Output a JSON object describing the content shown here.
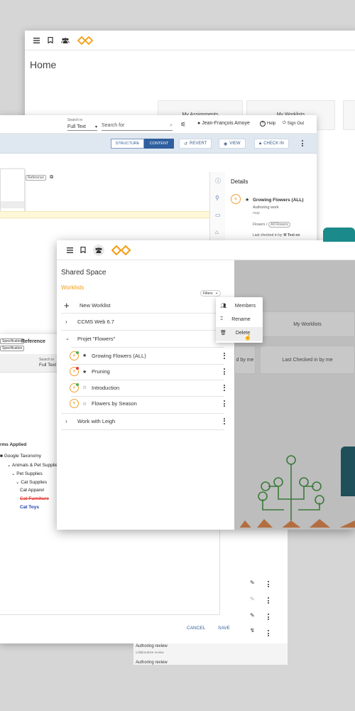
{
  "back_window": {
    "page_title": "Home",
    "tiles": [
      "My Assignments",
      "My Worklists"
    ]
  },
  "mid_window": {
    "search_in_label": "Search in",
    "search_in_value": "Full Text",
    "search_placeholder": "Search for",
    "user_name": "Jean-François Amoye",
    "help_label": "Help",
    "signout_label": "Sign Out",
    "structure_tab": "STRUCTURE",
    "content_tab": "CONTENT",
    "revert_label": "REVERT",
    "view_label": "VIEW",
    "checkin_label": "CHECK IN",
    "reference_chip": "Reference",
    "details": {
      "title": "Details",
      "item_title": "Growing Flowers (ALL)",
      "item_sub": "Authoring work",
      "item_type": "map",
      "path_prefix": "Flowers /",
      "path_chip": "All Flowers",
      "last_checked_prefix": "Last checked in by",
      "last_checked_user": "M Test on"
    }
  },
  "left_window": {
    "chips": [
      "Specification",
      "Specification"
    ],
    "reference_label": "Reference",
    "search_in_label": "Search in",
    "search_in_value": "Full Text",
    "terms_heading": "rms Applied",
    "tree": [
      {
        "label": "Google Taxonomy",
        "level": 0
      },
      {
        "label": "Animals & Pet Supplies",
        "level": 1
      },
      {
        "label": "Pet Supplies",
        "level": 2
      },
      {
        "label": "Cat Supplies",
        "level": 3
      },
      {
        "label": "Cat Apparel",
        "level": 4
      },
      {
        "label": "Cat Furniture",
        "level": 4
      },
      {
        "label": "Cat Toys",
        "level": 4
      }
    ],
    "cancel_label": "CANCEL",
    "save_label": "SAVE",
    "bottom_items": [
      "Authoring review",
      "collaborative review",
      "Authoring review"
    ]
  },
  "front_window": {
    "title": "Shared Space",
    "section": "Worklists",
    "filters_label": "Filters",
    "new_worklist": "New Worklist",
    "groups": [
      {
        "label": "CCMS Web 6.7"
      },
      {
        "label": "Projet \"Flowers\""
      }
    ],
    "items": [
      {
        "label": "Growing Flowers (ALL)",
        "star": "★",
        "dot": "#4caf50"
      },
      {
        "label": "Pruning",
        "star": "★",
        "dot": "#e53935"
      },
      {
        "label": "Introduction",
        "star": "☆",
        "dot": "#4caf50"
      },
      {
        "label": "Flowers by Season",
        "star": "☆",
        "dot": ""
      }
    ],
    "last_group": "Work with Leigh",
    "context_menu": [
      "Members",
      "Rename",
      "Delete"
    ],
    "right_tiles": [
      "My Worklists",
      "d by me",
      "Last Checked in by me"
    ]
  },
  "colors": {
    "brand_orange": "#f39c12",
    "accent_blue": "#2f5f9e"
  }
}
